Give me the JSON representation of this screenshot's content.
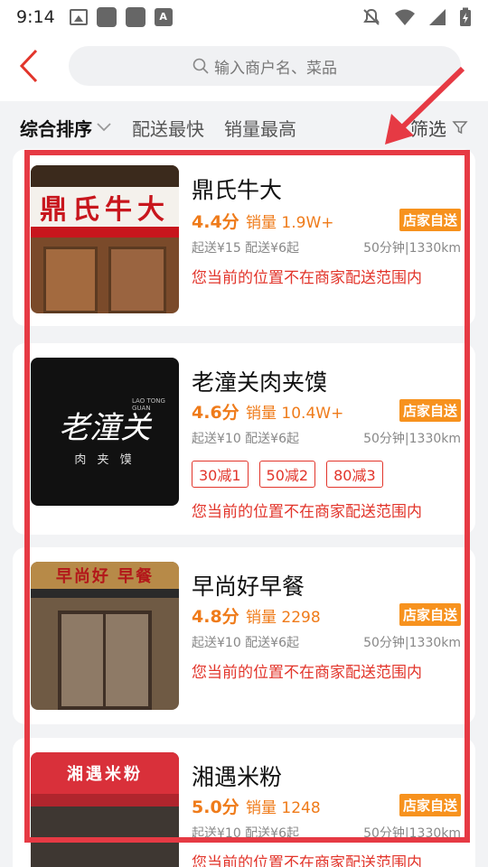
{
  "status": {
    "time": "9:14"
  },
  "search": {
    "placeholder": "输入商户名、菜品"
  },
  "sort": {
    "items": [
      "综合排序",
      "配送最快",
      "销量最高"
    ],
    "filter": "筛选"
  },
  "colors": {
    "accent": "#ef7b1a",
    "warning": "#e2352b",
    "badge": "#f7921e",
    "annotation": "#e63a44"
  },
  "stores": [
    {
      "name": "鼎氏牛大",
      "rating": "4.4分",
      "sales": "销量 1.9W+",
      "badge": "店家自送",
      "min_order": "起送¥15 配送¥6起",
      "eta_distance": "50分钟|1330km",
      "coupons": [],
      "warning": "您当前的位置不在商家配送范围内",
      "thumb_sign": "鼎氏牛大"
    },
    {
      "name": "老潼关肉夹馍",
      "rating": "4.6分",
      "sales": "销量 10.4W+",
      "badge": "店家自送",
      "min_order": "起送¥10 配送¥6起",
      "eta_distance": "50分钟|1330km",
      "coupons": [
        "30减1",
        "50减2",
        "80减3"
      ],
      "warning": "您当前的位置不在商家配送范围内",
      "thumb_logo": "老潼关",
      "thumb_sub": "肉 夹 馍",
      "thumb_en": "LAO TONG GUAN"
    },
    {
      "name": "早尚好早餐",
      "rating": "4.8分",
      "sales": "销量 2298",
      "badge": "店家自送",
      "min_order": "起送¥10 配送¥6起",
      "eta_distance": "50分钟|1330km",
      "coupons": [],
      "warning": "您当前的位置不在商家配送范围内",
      "thumb_sign": "早尚好 早餐"
    },
    {
      "name": "湘遇米粉",
      "rating": "5.0分",
      "sales": "销量 1248",
      "badge": "店家自送",
      "min_order": "起送¥10 配送¥6起",
      "eta_distance": "50分钟|1330km",
      "coupons": [],
      "warning": "您当前的位置不在商家配送范围内",
      "thumb_sign": "湘遇米粉"
    }
  ]
}
